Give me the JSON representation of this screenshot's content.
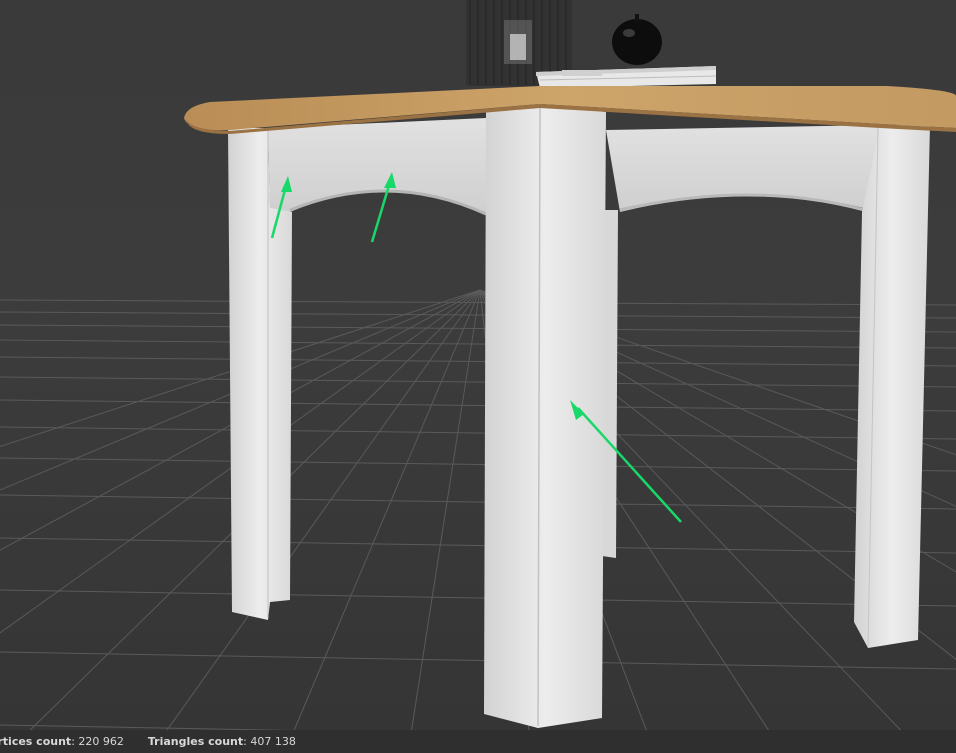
{
  "viewport": {
    "scene_name": "3d-model-viewer",
    "colors": {
      "background": "#3b3b3b",
      "grid": "#5a5a5a",
      "tabletop": "#c49a5e",
      "paint": "#e9e9e9",
      "annotation_arrow": "#19d86a"
    },
    "annotation_arrow_count": 3
  },
  "status": {
    "vertices_label": "Vertices count",
    "vertices_value": "220 962",
    "triangles_label": "Triangles count",
    "triangles_value": "407 138"
  }
}
